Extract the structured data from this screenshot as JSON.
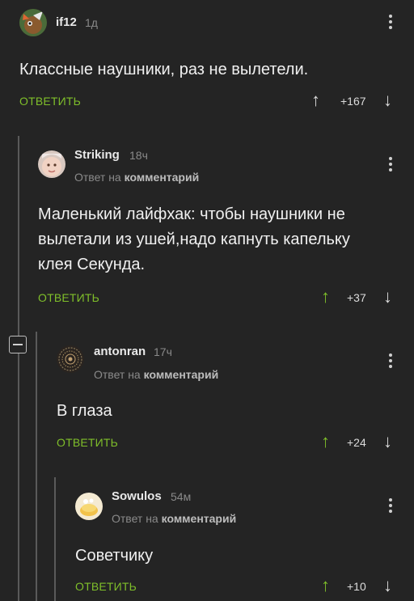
{
  "comments": [
    {
      "username": "if12",
      "time": "1д",
      "text": "Классные наушники, раз не вылетели.",
      "reply_label": "ОТВЕТИТЬ",
      "rating": "+167",
      "upvote_active": false
    },
    {
      "username": "Striking",
      "time": "18ч",
      "reply_to_prefix": "Ответ на",
      "reply_to_target": "комментарий",
      "text_lines": [
        "Маленький лайфхак: чтобы наушники не",
        "вылетали из ушей,надо капнуть капельку",
        "клея Секунда."
      ],
      "reply_label": "ОТВЕТИТЬ",
      "rating": "+37",
      "upvote_active": true
    },
    {
      "username": "antonran",
      "time": "17ч",
      "reply_to_prefix": "Ответ на",
      "reply_to_target": "комментарий",
      "text": "В глаза",
      "reply_label": "ОТВЕТИТЬ",
      "rating": "+24",
      "upvote_active": true
    },
    {
      "username": "Sowulos",
      "time": "54м",
      "reply_to_prefix": "Ответ на",
      "reply_to_target": "комментарий",
      "text": "Советчику",
      "reply_label": "ОТВЕТИТЬ",
      "rating": "+10",
      "upvote_active": true
    }
  ],
  "icons": {
    "upvote": "arrow-up-icon",
    "downvote": "arrow-down-icon",
    "menu": "kebab-menu-icon",
    "collapse": "collapse-thread-icon"
  },
  "colors": {
    "background": "#242424",
    "accent_green": "#7fbf2a",
    "muted_text": "#8a8a8a"
  }
}
